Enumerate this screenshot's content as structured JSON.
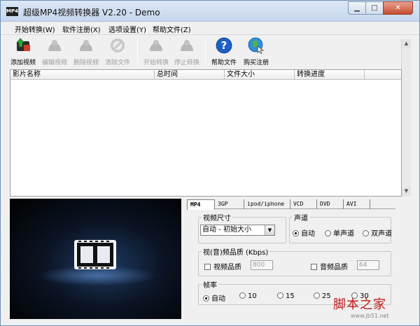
{
  "window": {
    "title": "超级MP4视频转换器 V2.20 - Demo",
    "app_icon_text": "MP4",
    "min_glyph": "▁",
    "max_glyph": "□",
    "close_glyph": "✕"
  },
  "menu": {
    "items": [
      {
        "label": "开始转换(W)"
      },
      {
        "label": "软件注册(X)"
      },
      {
        "label": "选项设置(Y)"
      },
      {
        "label": "帮助文件(Z)"
      }
    ]
  },
  "toolbar": {
    "add_video": "添加视频",
    "edit_video": "编辑视频",
    "delete_video": "删除视频",
    "clear_files": "清除文件",
    "start_convert": "开始转换",
    "stop_convert": "停止转换",
    "help_file": "帮助文件",
    "buy_register": "购买注册"
  },
  "file_list": {
    "columns": [
      "影片名称",
      "总时间",
      "文件大小",
      "转换进度"
    ],
    "rows": []
  },
  "format_tabs": [
    "MP4",
    "3GP",
    "ipod/iphone",
    "VCD",
    "DVD",
    "AVI"
  ],
  "selected_tab": "MP4",
  "video_size": {
    "label": "视频尺寸",
    "value": "自动 - 初始大小"
  },
  "audio_channel": {
    "label": "声道",
    "options": [
      "自动",
      "单声道",
      "双声道"
    ],
    "selected": "自动"
  },
  "quality": {
    "label": "视(音)频品质 (Kbps)",
    "video_label": "视频品质",
    "video_value": "800",
    "audio_label": "音频品质",
    "audio_value": "64"
  },
  "frame_rate": {
    "label": "帧率",
    "options": [
      "自动",
      "10",
      "15",
      "25",
      "30"
    ],
    "selected": "自动"
  },
  "watermark": {
    "text": "脚本之家",
    "url": "www.jb51.net"
  },
  "colors": {
    "title_bar": "#c6d7ec",
    "close_button": "#c54c31",
    "watermark": "#c01818",
    "preview_glow": "#1d3a62"
  }
}
